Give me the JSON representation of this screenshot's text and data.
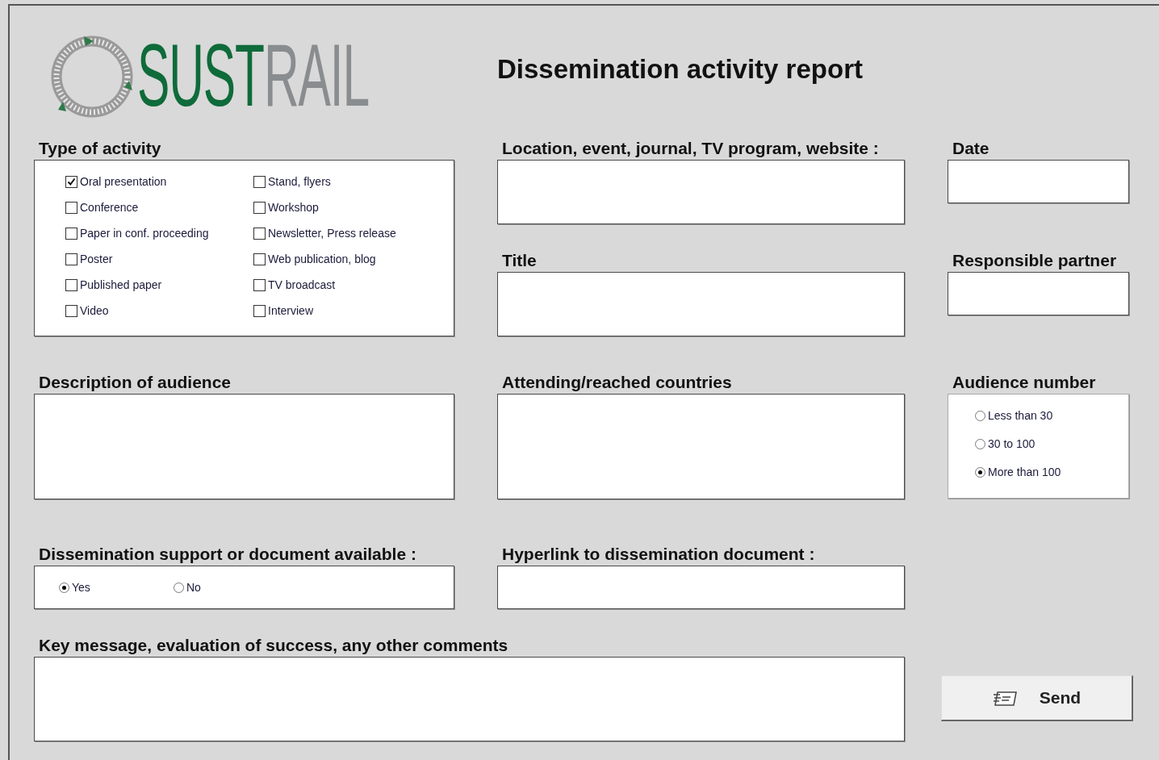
{
  "logo": {
    "part_1": "SUST",
    "part_2": "RAIL"
  },
  "title": "Dissemination activity report",
  "activity_type": {
    "label": "Type of activity",
    "options": [
      {
        "label": "Oral presentation",
        "checked": true
      },
      {
        "label": "Conference",
        "checked": false
      },
      {
        "label": "Paper in conf. proceeding",
        "checked": false
      },
      {
        "label": "Poster",
        "checked": false
      },
      {
        "label": "Published paper",
        "checked": false
      },
      {
        "label": "Video",
        "checked": false
      },
      {
        "label": "Stand, flyers",
        "checked": false
      },
      {
        "label": "Workshop",
        "checked": false
      },
      {
        "label": "Newsletter, Press release",
        "checked": false
      },
      {
        "label": "Web publication, blog",
        "checked": false
      },
      {
        "label": "TV broadcast",
        "checked": false
      },
      {
        "label": "Interview",
        "checked": false
      }
    ]
  },
  "location": {
    "label": "Location, event, journal, TV program, website :"
  },
  "date": {
    "label": "Date"
  },
  "title_field": {
    "label": "Title"
  },
  "partner": {
    "label": "Responsible partner"
  },
  "audience_description": {
    "label": "Description of audience"
  },
  "countries": {
    "label": "Attending/reached countries"
  },
  "audience_number": {
    "label": "Audience number",
    "options": [
      {
        "label": "Less than 30",
        "selected": false
      },
      {
        "label": "30 to 100",
        "selected": false
      },
      {
        "label": "More than 100",
        "selected": true
      }
    ]
  },
  "support": {
    "label": "Dissemination support or document available :",
    "options": [
      {
        "label": "Yes",
        "selected": true
      },
      {
        "label": "No",
        "selected": false
      }
    ]
  },
  "hyperlink": {
    "label": "Hyperlink to dissemination document :"
  },
  "comments": {
    "label": "Key message, evaluation of success, any other comments"
  },
  "send_button": {
    "label": "Send"
  }
}
